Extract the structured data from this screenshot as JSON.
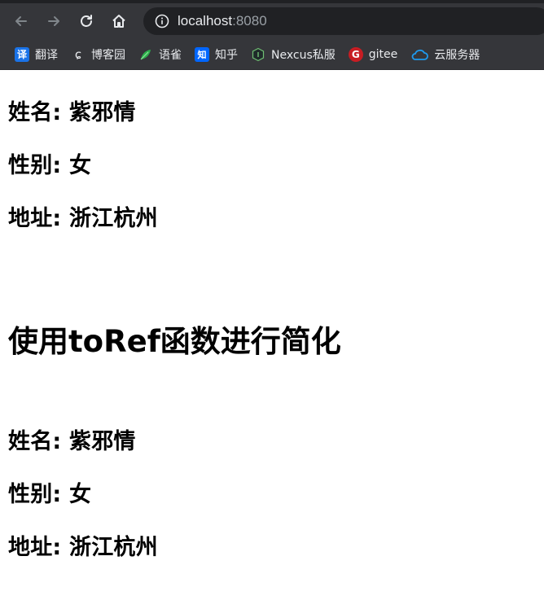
{
  "browser": {
    "url_host": "localhost",
    "url_port": ":8080"
  },
  "bookmarks": [
    {
      "label": "翻译",
      "icon": "translate-icon",
      "color": "#1a73e8",
      "glyph": "译"
    },
    {
      "label": "博客园",
      "icon": "cnblogs-icon",
      "color": "#35363a",
      "glyph": "ɕ"
    },
    {
      "label": "语雀",
      "icon": "yuque-icon",
      "color": "#35363a",
      "glyph": ""
    },
    {
      "label": "知乎",
      "icon": "zhihu-icon",
      "color": "#0066ff",
      "glyph": "知"
    },
    {
      "label": "Nexcus私服",
      "icon": "nexus-icon",
      "color": "#35363a",
      "glyph": ""
    },
    {
      "label": "gitee",
      "icon": "gitee-icon",
      "color": "#c71d23",
      "glyph": "G"
    },
    {
      "label": "云服务器",
      "icon": "cloud-icon",
      "color": "#35363a",
      "glyph": ""
    }
  ],
  "group1": {
    "name": "姓名: 紫邪情",
    "gender": "性别: 女",
    "address": "地址: 浙江杭州"
  },
  "section_title": "使用toRef函数进行简化",
  "group2": {
    "name": "姓名: 紫邪情",
    "gender": "性别: 女",
    "address": "地址: 浙江杭州"
  }
}
